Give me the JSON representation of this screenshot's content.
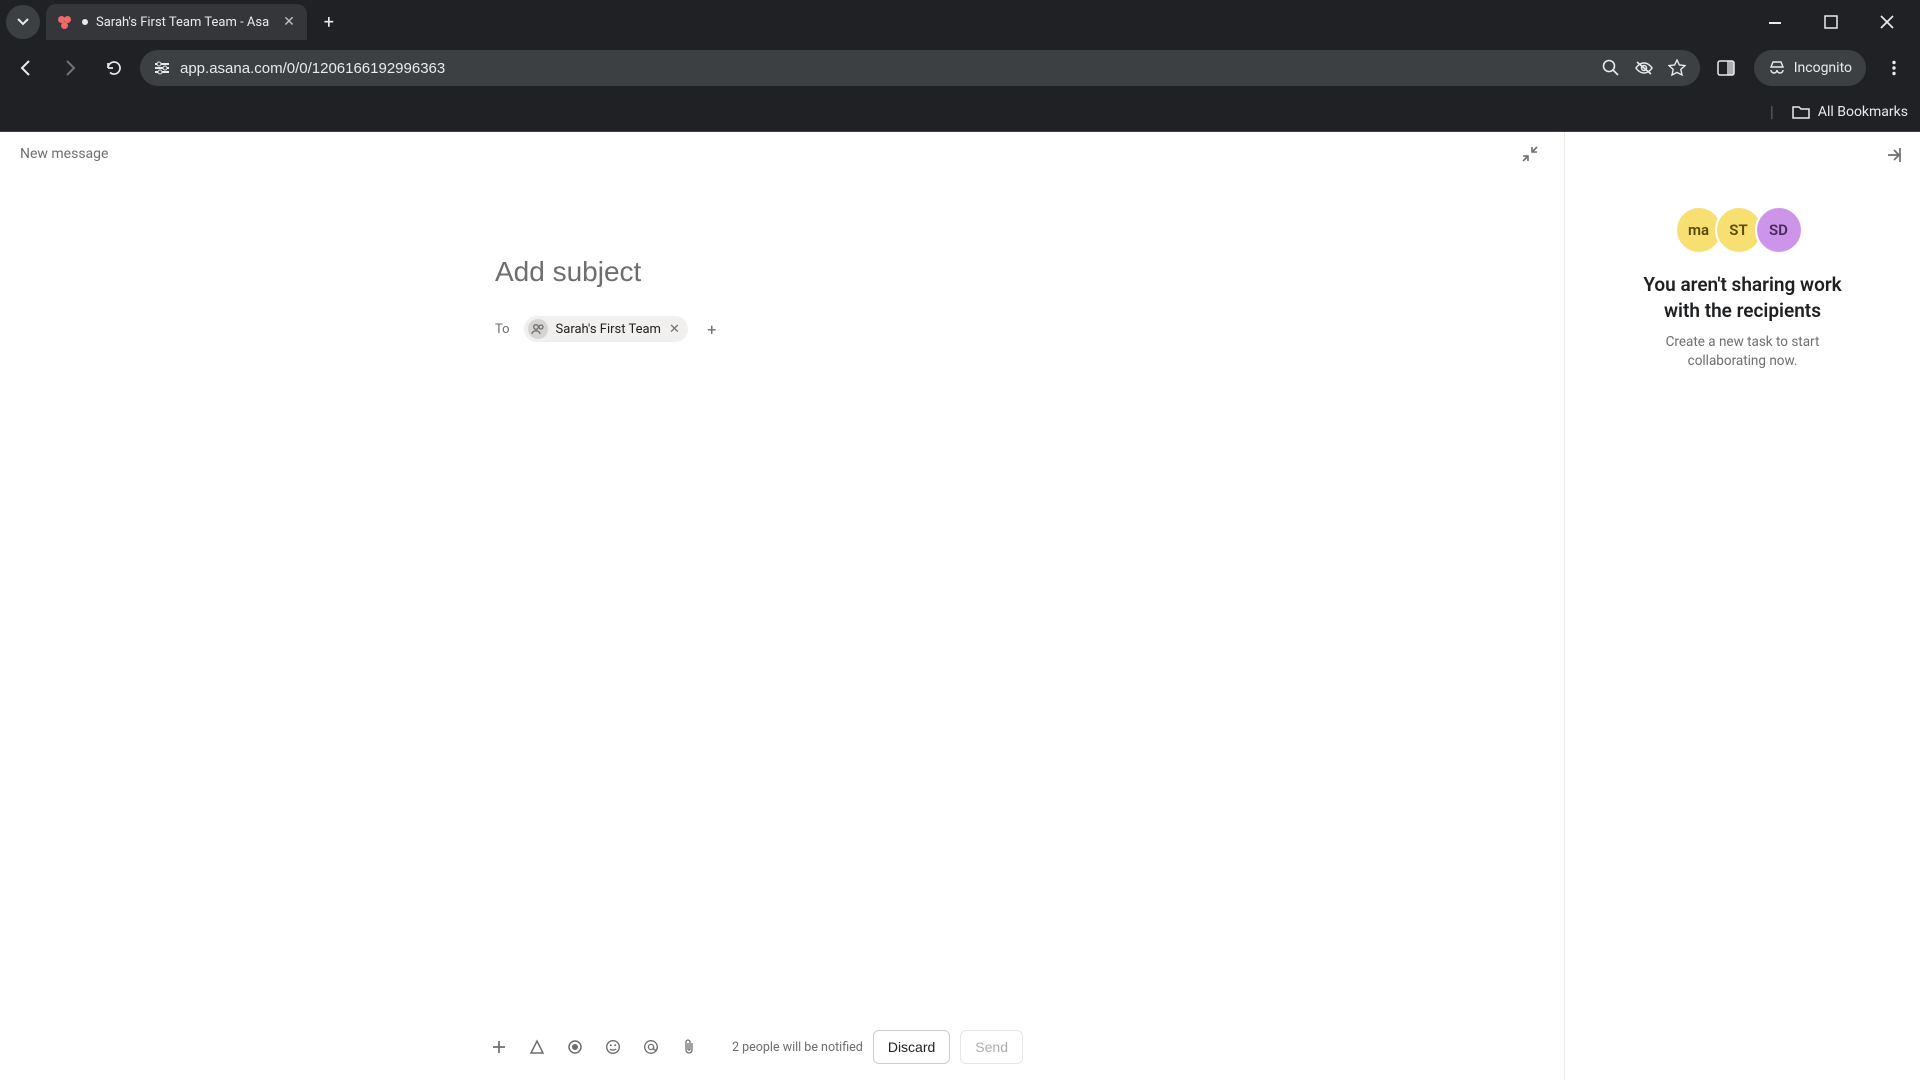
{
  "browser": {
    "tab_title": "Sarah's First Team Team - Asa",
    "url": "app.asana.com/0/0/1206166192996363",
    "new_tab_label": "+",
    "incognito_label": "Incognito",
    "all_bookmarks_label": "All Bookmarks"
  },
  "header": {
    "title": "New message"
  },
  "compose": {
    "subject_placeholder": "Add subject",
    "to_label": "To",
    "recipient_chip": "Sarah's First Team",
    "add_recipient_glyph": "+"
  },
  "footer": {
    "notify_text": "2 people will be notified",
    "discard_label": "Discard",
    "send_label": "Send"
  },
  "sidebar": {
    "avatars": [
      "ma",
      "ST",
      "SD"
    ],
    "heading_line1": "You aren't sharing work",
    "heading_line2": "with the recipients",
    "body_line1": "Create a new task to start",
    "body_line2": "collaborating now."
  }
}
